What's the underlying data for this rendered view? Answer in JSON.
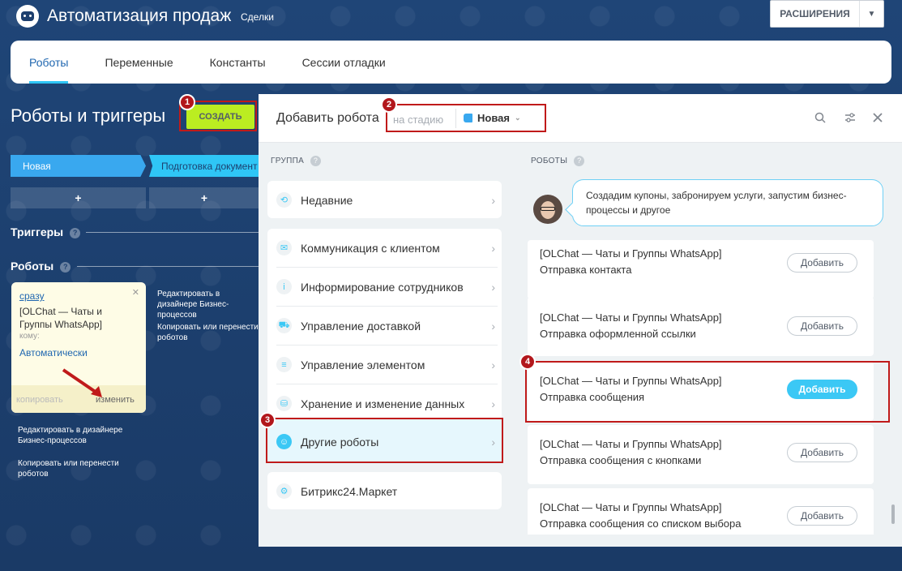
{
  "header": {
    "app_title": "Автоматизация продаж",
    "app_subtitle": "Сделки",
    "extensions_label": "РАСШИРЕНИЯ"
  },
  "tabs": [
    {
      "label": "Роботы",
      "active": true
    },
    {
      "label": "Переменные",
      "active": false
    },
    {
      "label": "Константы",
      "active": false
    },
    {
      "label": "Сессии отладки",
      "active": false
    }
  ],
  "main": {
    "title": "Роботы и триггеры",
    "create_label": "СОЗДАТЬ",
    "stages": [
      "Новая",
      "Подготовка документ"
    ],
    "add_symbol": "+",
    "triggers_label": "Триггеры",
    "robots_label": "Роботы",
    "help_symbol": "?"
  },
  "robot_card": {
    "when": "сразу",
    "name": "[OLChat — Чаты и Группы WhatsApp]",
    "to_label": "кому:",
    "to_value": "Автоматически",
    "copy_label": "копировать",
    "edit_label": "изменить"
  },
  "side_links": {
    "edit_in_designer": "Редактировать в дизайнере Бизнес-процессов",
    "copy_or_move": "Копировать или перенести роботов"
  },
  "badges": [
    "1",
    "2",
    "3",
    "4"
  ],
  "modal": {
    "title": "Добавить робота",
    "stage_placeholder": "на стадию",
    "stage_value": "Новая",
    "group_label": "ГРУППА",
    "robots_label": "РОБОТЫ",
    "groups": [
      {
        "label": "Недавние",
        "icon": "history-icon",
        "glyph": "⟲"
      },
      {
        "label": "Коммуникация с клиентом",
        "icon": "chat-icon",
        "glyph": "✉"
      },
      {
        "label": "Информирование сотрудников",
        "icon": "info-icon",
        "glyph": "i"
      },
      {
        "label": "Управление доставкой",
        "icon": "truck-icon",
        "glyph": "⛟"
      },
      {
        "label": "Управление элементом",
        "icon": "filter-icon",
        "glyph": "≡"
      },
      {
        "label": "Хранение и изменение данных",
        "icon": "database-icon",
        "glyph": "⛁"
      },
      {
        "label": "Другие роботы",
        "icon": "robot-icon",
        "glyph": "☺"
      },
      {
        "label": "Битрикс24.Маркет",
        "icon": "market-icon",
        "glyph": "⚙"
      }
    ],
    "hint": "Создадим купоны, забронируем услуги, запустим бизнес-процессы и другое",
    "add_label": "Добавить",
    "robots": [
      {
        "provider": "[OLChat — Чаты и Группы WhatsApp]",
        "name": "Отправка контакта"
      },
      {
        "provider": "[OLChat — Чаты и Группы WhatsApp]",
        "name": "Отправка оформленной ссылки"
      },
      {
        "provider": "[OLChat — Чаты и Группы WhatsApp]",
        "name": "Отправка сообщения"
      },
      {
        "provider": "[OLChat — Чаты и Группы WhatsApp]",
        "name": "Отправка сообщения с кнопками"
      },
      {
        "provider": "[OLChat — Чаты и Группы WhatsApp]",
        "name": "Отправка сообщения со списком выбора"
      }
    ]
  },
  "colors": {
    "background": "#1d3f6e",
    "accent": "#3bc8f5",
    "create_button": "#bbed21",
    "highlight_frame": "#c01a1a"
  }
}
